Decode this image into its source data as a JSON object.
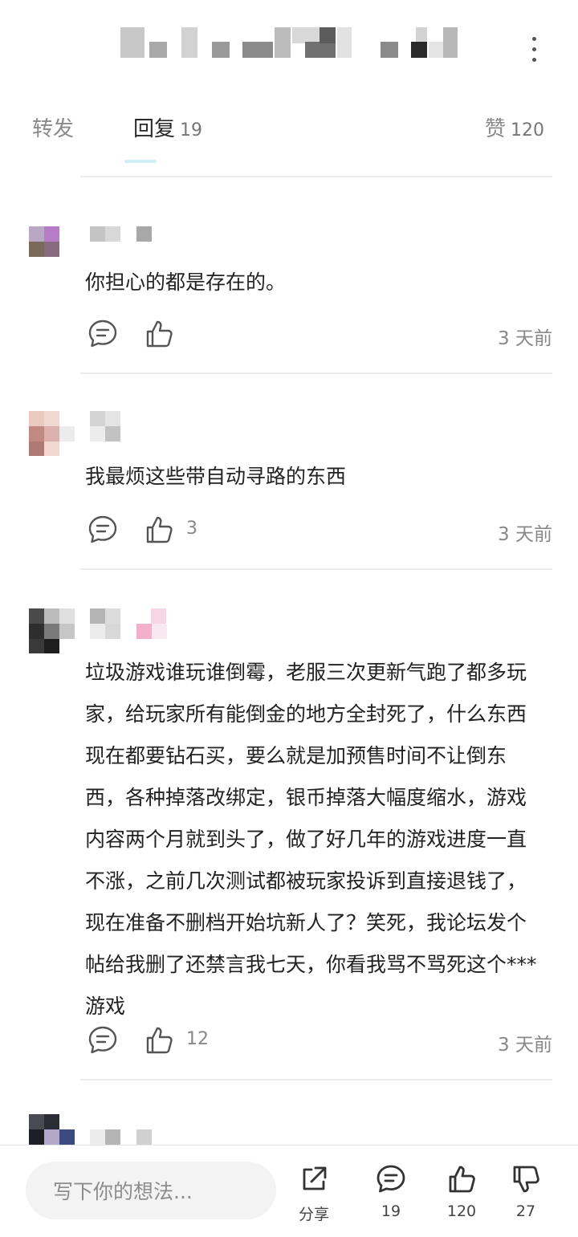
{
  "tabs": [
    {
      "label": "转发",
      "count": ""
    },
    {
      "label": "回复",
      "count": "19"
    },
    {
      "label": "赞",
      "count": "120"
    }
  ],
  "comments": [
    {
      "text": "你担心的都是存在的。",
      "likes": "",
      "time": "3 天前"
    },
    {
      "text": "我最烦这些带自动寻路的东西",
      "likes": "3",
      "time": "3 天前"
    },
    {
      "text": "垃圾游戏谁玩谁倒霉，老服三次更新气跑了都多玩家，给玩家所有能倒金的地方全封死了，什么东西现在都要钻石买，要么就是加预售时间不让倒东西，各种掉落改绑定，银币掉落大幅度缩水，游戏内容两个月就到头了，做了好几年的游戏进度一直不涨，之前几次测试都被玩家投诉到直接退钱了，现在准备不删档开始坑新人了？笑死，我论坛发个帖给我删了还禁言我七天，你看我骂不骂死这个***游戏",
      "likes": "12",
      "time": "3 天前"
    }
  ],
  "bottom_bar": {
    "input_placeholder": "写下你的想法...",
    "share_label": "分享",
    "comment_count": "19",
    "like_count": "120",
    "dislike_count": "27"
  },
  "icons": {
    "more": "more-vertical-icon",
    "reply": "comment-bubble-icon",
    "like": "thumbs-up-icon",
    "share": "share-icon",
    "dislike": "thumbs-down-icon"
  },
  "colors": {
    "tab_indicator": "#cfeff4",
    "secondary_text": "#888888",
    "divider": "#ececec",
    "input_bg": "#f3f3f3"
  }
}
